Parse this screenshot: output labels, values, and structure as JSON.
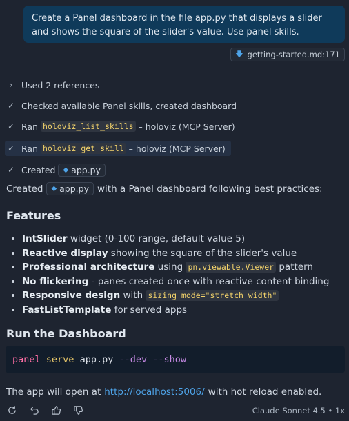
{
  "user_message": "Create a Panel dashboard in the file app.py that displays a slider and shows the square of the slider's value. Use panel skills.",
  "reference_chip": "getting-started.md:171",
  "steps": [
    {
      "icon": "chevron-right-icon",
      "text": "Used 2 references"
    },
    {
      "icon": "check-icon",
      "text": "Checked available Panel skills, created dashboard"
    },
    {
      "icon": "check-icon",
      "pre": "Ran",
      "code": "holoviz_list_skills",
      "post": "– holoviz (MCP Server)"
    },
    {
      "icon": "check-icon",
      "pre": "Ran",
      "code": "holoviz_get_skill",
      "post": "– holoviz (MCP Server)"
    },
    {
      "icon": "check-icon",
      "pre": "Created",
      "file": "app.py"
    }
  ],
  "summary": {
    "pre": "Created",
    "file": "app.py",
    "post": "with a Panel dashboard following best practices:"
  },
  "features_heading": "Features",
  "features": [
    {
      "bold": "IntSlider",
      "text": " widget (0-100 range, default value 5)"
    },
    {
      "bold": "Reactive display",
      "text": " showing the square of the slider's value"
    },
    {
      "bold": "Professional architecture",
      "text": " using ",
      "code": "pn.viewable.Viewer",
      "after": " pattern"
    },
    {
      "bold": "No flickering",
      "text": " - panes created once with reactive content binding"
    },
    {
      "bold": "Responsive design",
      "text": " with ",
      "code": "sizing_mode=\"stretch_width\"",
      "after": ""
    },
    {
      "bold": "FastListTemplate",
      "text": " for served apps"
    }
  ],
  "run_heading": "Run the Dashboard",
  "command": {
    "cmd": "panel",
    "sub": "serve",
    "arg": "app.py",
    "flags": "--dev --show"
  },
  "closing": {
    "pre": "The app will open at",
    "link": "http://localhost:5006/",
    "post": "with hot reload enabled."
  },
  "model_label": "Claude Sonnet 4.5 • 1x",
  "footer_icons": [
    "retry-icon",
    "undo-icon",
    "thumbs-up-icon",
    "thumbs-down-icon"
  ]
}
